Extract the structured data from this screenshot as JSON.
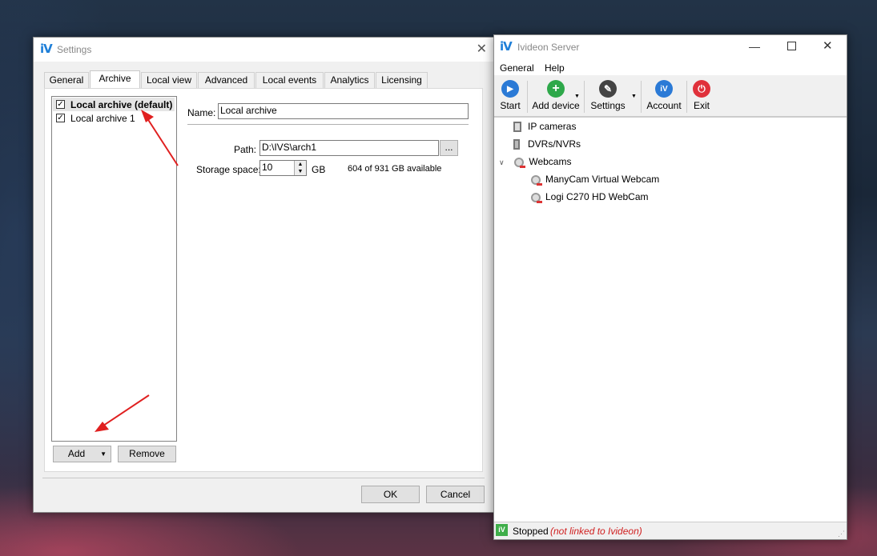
{
  "settings": {
    "title": "Settings",
    "logo": "iV",
    "tabs": [
      "General",
      "Archive",
      "Local view",
      "Advanced",
      "Local events",
      "Analytics",
      "Licensing"
    ],
    "active_tab": "Archive",
    "archives": [
      {
        "label": "Local archive (default)",
        "checked": true
      },
      {
        "label": "Local archive 1",
        "checked": true
      }
    ],
    "name_label": "Name:",
    "name_value": "Local archive",
    "path_label": "Path:",
    "path_value": "D:\\IVS\\arch1",
    "browse_label": "...",
    "storage_label": "Storage space:",
    "storage_value": "10",
    "storage_unit": "GB",
    "storage_available": "604 of 931 GB available",
    "add_label": "Add",
    "remove_label": "Remove",
    "ok_label": "OK",
    "cancel_label": "Cancel"
  },
  "server": {
    "title": "Ivideon Server",
    "logo": "iV",
    "menu": [
      "General",
      "Help"
    ],
    "toolbar": [
      {
        "label": "Start",
        "icon": "play-icon",
        "color": "#2b7ad6"
      },
      {
        "label": "Add device",
        "icon": "plus-icon",
        "color": "#2ea84a"
      },
      {
        "label": "Settings",
        "icon": "wrench-icon",
        "color": "#444"
      },
      {
        "label": "Account",
        "icon": "ivideon-icon",
        "color": "#2b7ad6"
      },
      {
        "label": "Exit",
        "icon": "power-icon",
        "color": "#e0313b"
      }
    ],
    "tree": [
      {
        "label": "IP cameras",
        "icon": "ip-camera-icon"
      },
      {
        "label": "DVRs/NVRs",
        "icon": "dvr-icon"
      },
      {
        "label": "Webcams",
        "icon": "webcam-icon",
        "expanded": true
      },
      {
        "label": "ManyCam Virtual Webcam",
        "icon": "webcam-disabled-icon"
      },
      {
        "label": "Logi C270 HD WebCam",
        "icon": "webcam-disabled-icon"
      }
    ],
    "status": "Stopped",
    "status_note": "(not linked to Ivideon)"
  }
}
